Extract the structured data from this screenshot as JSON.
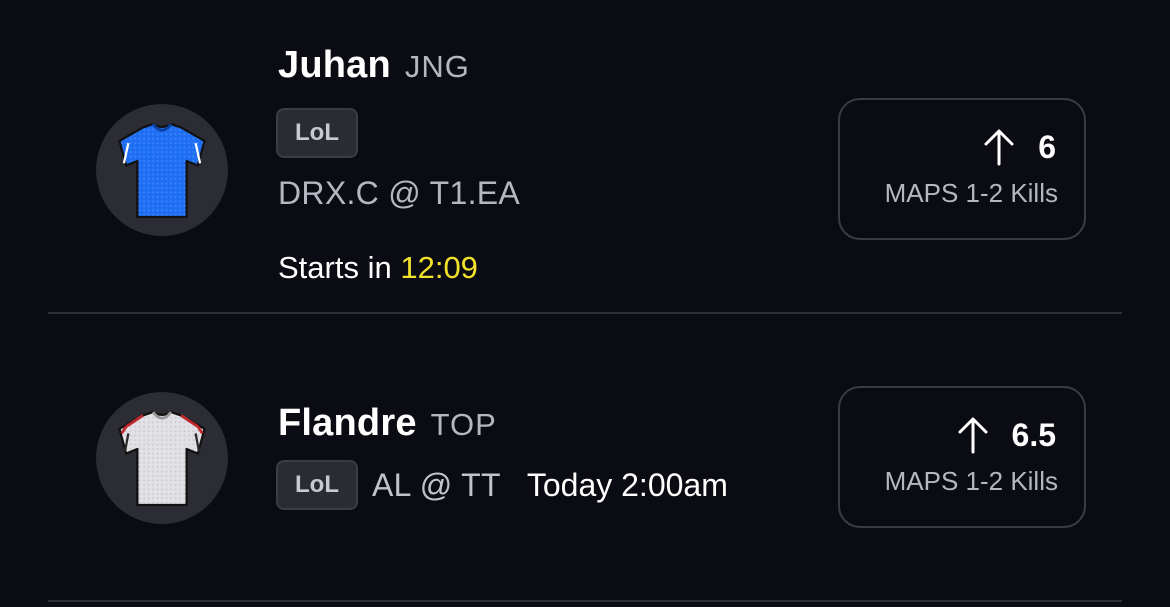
{
  "projections": [
    {
      "player_name": "Juhan",
      "position": "JNG",
      "league_badge": "LoL",
      "matchup": "DRX.C @ T1.EA",
      "start_prefix": "Starts in",
      "start_countdown": "12:09",
      "stat_value": "6",
      "stat_label": "MAPS 1-2 Kills",
      "jersey_icon": "blue-jersey-icon",
      "direction_icon": "arrow-up-icon"
    },
    {
      "player_name": "Flandre",
      "position": "TOP",
      "league_badge": "LoL",
      "matchup": "AL @ TT",
      "start_time": "Today 2:00am",
      "stat_value": "6.5",
      "stat_label": "MAPS 1-2 Kills",
      "jersey_icon": "white-jersey-icon",
      "direction_icon": "arrow-up-icon"
    }
  ],
  "colors": {
    "background": "#0b0b14",
    "countdown": "#f2e32a",
    "jersey_blue": "#1e6ff0",
    "jersey_white": "#e4e4e8"
  }
}
